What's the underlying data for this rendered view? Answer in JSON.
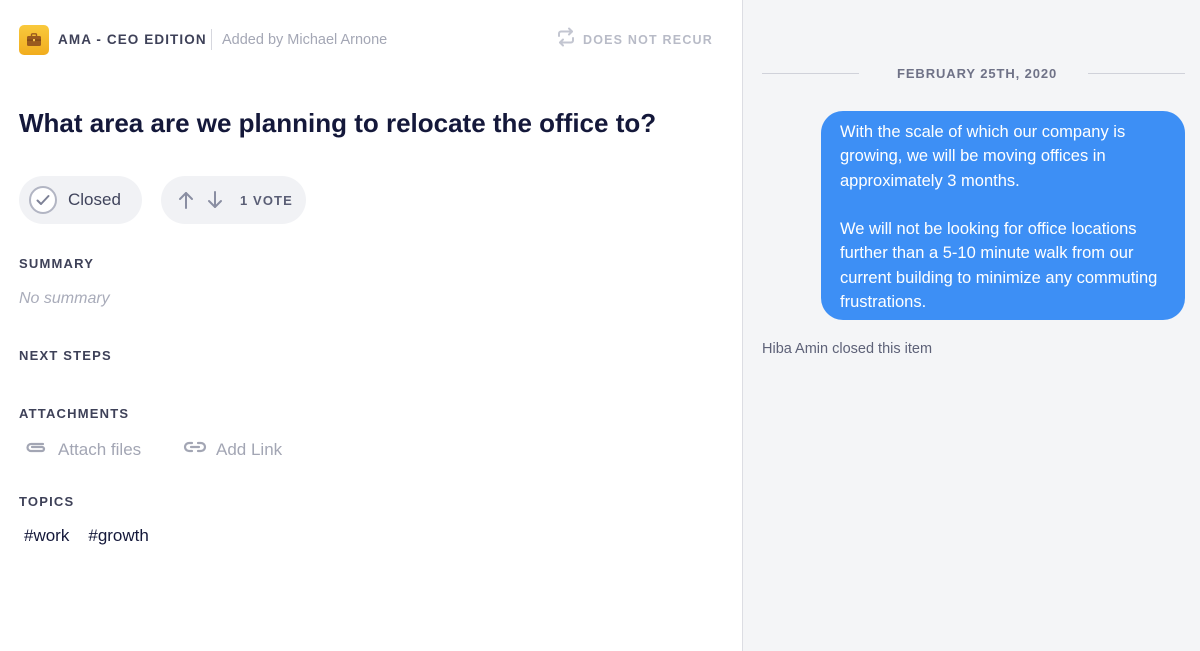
{
  "header": {
    "meeting_icon": "briefcase-icon",
    "meeting_name": "AMA - CEO EDITION",
    "added_by": "Added by Michael Arnone",
    "recurrence_icon": "repeat-icon",
    "recurrence": "DOES NOT RECUR"
  },
  "item": {
    "title": "What area are we planning to relocate the office to?",
    "status": {
      "icon": "check-icon",
      "label": "Closed"
    },
    "votes": {
      "up_icon": "arrow-up-icon",
      "down_icon": "arrow-down-icon",
      "label": "1 VOTE"
    }
  },
  "sections": {
    "summary": {
      "heading": "SUMMARY",
      "empty_text": "No summary"
    },
    "next_steps": {
      "heading": "NEXT STEPS"
    },
    "attachments": {
      "heading": "ATTACHMENTS",
      "attach_files": {
        "icon": "paperclip-icon",
        "label": "Attach files"
      },
      "add_link": {
        "icon": "link-icon",
        "label": "Add Link"
      }
    },
    "topics": {
      "heading": "TOPICS",
      "tags": [
        "#work",
        "#growth"
      ]
    }
  },
  "activity_panel": {
    "date": "FEBRUARY 25TH, 2020",
    "message_paragraphs": [
      "With the scale of which our company is growing, we will be moving offices in approximately 3 months.",
      "We will not be looking for office locations further than a 5-10 minute walk from our current building to minimize any commuting frustrations."
    ],
    "event": "Hiba Amin closed this item"
  },
  "colors": {
    "accent_blue": "#3d8ff5",
    "meeting_icon_yellow": "#f4b728",
    "panel_background": "#f4f5f7",
    "title_text": "#14183a"
  }
}
